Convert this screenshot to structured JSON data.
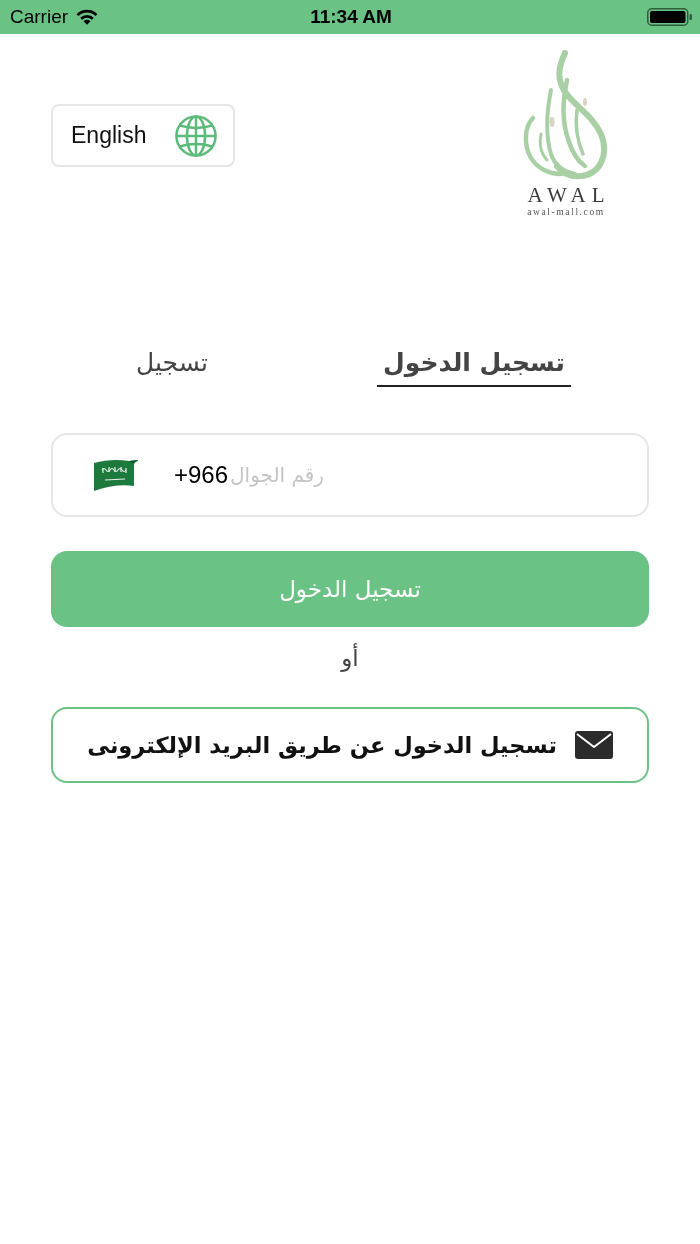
{
  "status_bar": {
    "carrier": "Carrier",
    "time": "11:34 AM"
  },
  "header": {
    "language_button": {
      "label": "English"
    },
    "logo": {
      "wordmark": "AWAL",
      "domain": "awal-mall.com"
    }
  },
  "tabs": [
    {
      "label": "تسجيل الدخول",
      "selected": true
    },
    {
      "label": "تسجيل",
      "selected": false
    }
  ],
  "phone_field": {
    "country_code": "+966",
    "placeholder": "رقم الجوال"
  },
  "login_button": {
    "label": "تسجيل الدخول"
  },
  "separator": "أو",
  "email_login_button": {
    "label": "تسجيل الدخول عن طريق البريد الإلكترونى"
  }
}
